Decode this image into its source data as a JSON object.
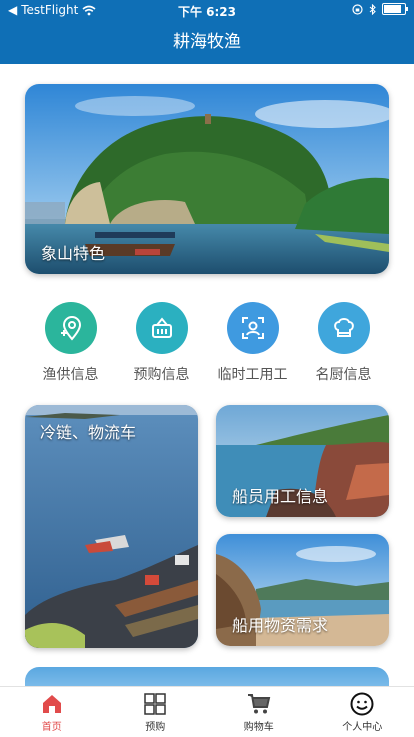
{
  "status_bar": {
    "back_app": "TestFlight",
    "time": "下午 6:23"
  },
  "nav": {
    "title": "耕海牧渔"
  },
  "banner": {
    "label": "象山特色"
  },
  "quick_menu": [
    {
      "label": "渔供信息",
      "icon": "location-pin-icon",
      "color": "#2bb59c"
    },
    {
      "label": "预购信息",
      "icon": "basket-icon",
      "color": "#2bb0c0"
    },
    {
      "label": "临时工用工",
      "icon": "face-scan-icon",
      "color": "#3f9ae0"
    },
    {
      "label": "名厨信息",
      "icon": "chef-hat-icon",
      "color": "#3fa6dc"
    }
  ],
  "tiles": {
    "cold_chain": "冷链、物流车",
    "crew": "船员用工信息",
    "supplies": "船用物资需求"
  },
  "tabs": [
    {
      "label": "首页",
      "icon": "home-icon",
      "active": true
    },
    {
      "label": "预购",
      "icon": "grid-icon",
      "active": false
    },
    {
      "label": "购物车",
      "icon": "cart-icon",
      "active": false
    },
    {
      "label": "个人中心",
      "icon": "smiley-icon",
      "active": false
    }
  ],
  "colors": {
    "brand": "#0f6fb6",
    "tab_active": "#e14b4b"
  }
}
